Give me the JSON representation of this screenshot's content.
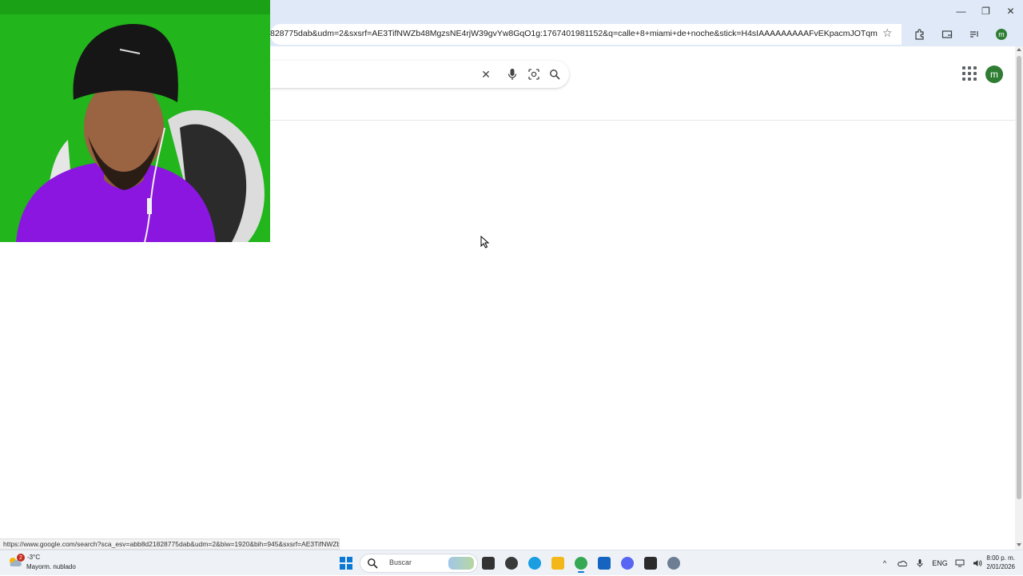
{
  "browser": {
    "url": "828775dab&udm=2&sxsrf=AE3TifNWZb48MgzsNE4rjW39gvYw8GqO1g:1767401981152&q=calle+8+miami+de+noche&stick=H4sIAAAAAAAAAFvEKpacmJOTqmChkJuZmJupkJKqkJe...",
    "profile_initial": "m"
  },
  "window_controls": {
    "minimize": "—",
    "restore": "❐",
    "close": "✕"
  },
  "page": {
    "search_clear": "✕",
    "profile_initial": "m"
  },
  "status_url": "https://www.google.com/search?sca_esv=abb8d21828775dab&udm=2&biw=1920&bih=945&sxsrf=AE3TifNWZb48...",
  "taskbar": {
    "weather_badge": "2",
    "weather_temp": "-3°C",
    "weather_desc": "Mayorm. nublado",
    "search_label": "Buscar",
    "tasks": [
      {
        "name": "file-explorer-task",
        "color": "#333333"
      },
      {
        "name": "obs-studio-task",
        "color": "#3a3a3a"
      },
      {
        "name": "edge-task",
        "color": "#1b9de2"
      },
      {
        "name": "folder-task",
        "color": "#f3b71a"
      },
      {
        "name": "chrome-task",
        "color": "#34a853"
      },
      {
        "name": "store-task",
        "color": "#1565c0"
      },
      {
        "name": "discord-task",
        "color": "#5865f2"
      },
      {
        "name": "epic-games-task",
        "color": "#2b2b2b"
      },
      {
        "name": "settings-task",
        "color": "#6d7d93"
      }
    ],
    "lang": "ENG",
    "time": "8:00 p. m.",
    "date": "2/01/2026"
  }
}
